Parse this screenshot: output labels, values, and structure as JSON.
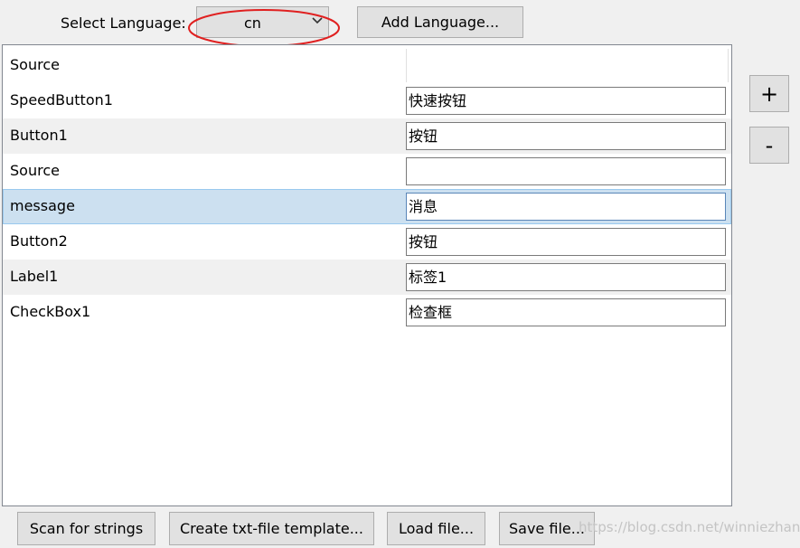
{
  "toolbar": {
    "select_language_label": "Select Language:",
    "language_value": "cn",
    "add_language_label": "Add Language..."
  },
  "table": {
    "header": {
      "source": "Source",
      "translation": ""
    },
    "rows": [
      {
        "source": "SpeedButton1",
        "translation": "快速按钮",
        "background": "#ffffff"
      },
      {
        "source": "Button1",
        "translation": "按钮",
        "background": "#f0f0f0"
      },
      {
        "source": "Source",
        "translation": "",
        "background": "#ffffff"
      },
      {
        "source": "message",
        "translation": "消息",
        "background": "#cce0f0",
        "selected": true
      },
      {
        "source": "Button2",
        "translation": "按钮",
        "background": "#ffffff"
      },
      {
        "source": "Label1",
        "translation": "标签1",
        "background": "#f0f0f0"
      },
      {
        "source": "CheckBox1",
        "translation": "检查框",
        "background": "#ffffff"
      }
    ]
  },
  "side": {
    "plus_label": "+",
    "minus_label": "-"
  },
  "bottom": {
    "scan_label": "Scan for strings",
    "template_label": "Create txt-file template...",
    "load_label": "Load file...",
    "save_label": "Save file..."
  },
  "watermark": "https://blog.csdn.net/winniezhang",
  "colors": {
    "window_bg": "#f0f0f0",
    "button_bg": "#e1e1e1",
    "selected_row": "#cce0f0",
    "alt_row": "#f0f0f0",
    "highlight_ring": "#e02020"
  },
  "icons": {
    "dropdown": "chevron-down-icon"
  }
}
